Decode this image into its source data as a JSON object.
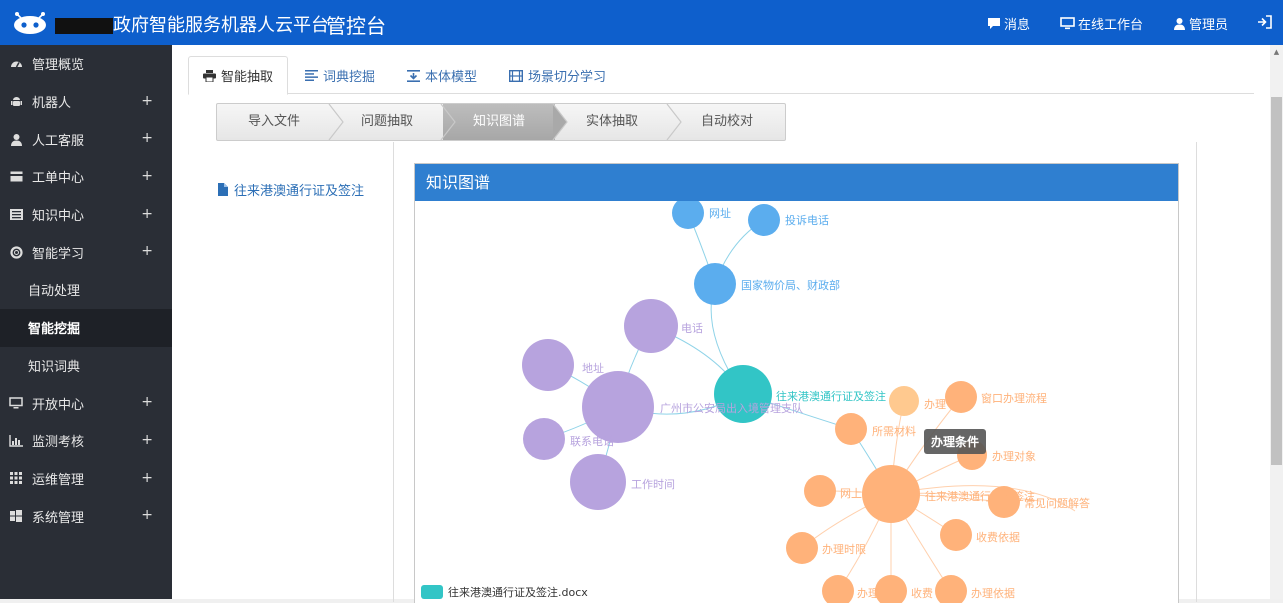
{
  "header": {
    "brand_title": "政府智能服务机器人云平台",
    "console_label": "管控台",
    "nav": {
      "messages": "消息",
      "online_workbench": "在线工作台",
      "admin": "管理员"
    }
  },
  "sidebar": {
    "items": [
      {
        "label": "管理概览",
        "icon": "dashboard-icon"
      },
      {
        "label": "机器人",
        "icon": "android-icon",
        "expand": "+"
      },
      {
        "label": "人工客服",
        "icon": "user-icon",
        "expand": "+"
      },
      {
        "label": "工单中心",
        "icon": "card-icon",
        "expand": "+"
      },
      {
        "label": "知识中心",
        "icon": "list-icon",
        "expand": "+"
      },
      {
        "label": "智能学习",
        "icon": "lifebuoy-icon",
        "expand": "+"
      },
      {
        "label": "开放中心",
        "icon": "monitor-icon",
        "expand": "+"
      },
      {
        "label": "监测考核",
        "icon": "bar-chart-icon",
        "expand": "+"
      },
      {
        "label": "运维管理",
        "icon": "grid-icon",
        "expand": "+"
      },
      {
        "label": "系统管理",
        "icon": "windows-icon",
        "expand": "+"
      }
    ],
    "sub_items": [
      "自动处理",
      "智能挖掘",
      "知识词典"
    ]
  },
  "tabs": [
    {
      "label": "智能抽取",
      "icon": "print-icon",
      "active": true
    },
    {
      "label": "词典挖掘",
      "icon": "list-lines-icon"
    },
    {
      "label": "本体模型",
      "icon": "download-tray-icon"
    },
    {
      "label": "场景切分学习",
      "icon": "film-icon"
    }
  ],
  "steps": [
    {
      "label": "导入文件"
    },
    {
      "label": "问题抽取"
    },
    {
      "label": "知识图谱",
      "active": true
    },
    {
      "label": "实体抽取"
    },
    {
      "label": "自动校对"
    }
  ],
  "file": {
    "name": "往来港澳通行证及签注"
  },
  "panel": {
    "title": "知识图谱"
  },
  "graph": {
    "tooltip": "办理条件",
    "legend": "往来港澳通行证及签注.docx",
    "colors": {
      "blue": "#5badee",
      "purple": "#b7a3de",
      "teal": "#32c5c6",
      "orange": "#ffb27a",
      "accent": "#0e5fcc"
    },
    "node_labels": {
      "wangzhi": "网址",
      "tousu": "投诉电话",
      "wujia": "国家物价局、财政部",
      "dianhua": "电话",
      "dizhi": "地址",
      "gongan": "广州市公安局出入境管理支队",
      "lianxi": "联系电话",
      "gongzuo": "工作时间",
      "center": "往来港澳通行证及签注",
      "banli": "办理",
      "chuangkou": "窗口办理流程",
      "cailiao": "所需材料",
      "duixiang": "办理对象",
      "wangshang": "网上",
      "hub": "往来港澳通行证及签注",
      "changjian": "常见问题解答",
      "shoufei": "收费依据",
      "shixian": "办理时限",
      "banli2": "办理",
      "shoufei2": "收费",
      "yiju": "办理依据"
    }
  }
}
